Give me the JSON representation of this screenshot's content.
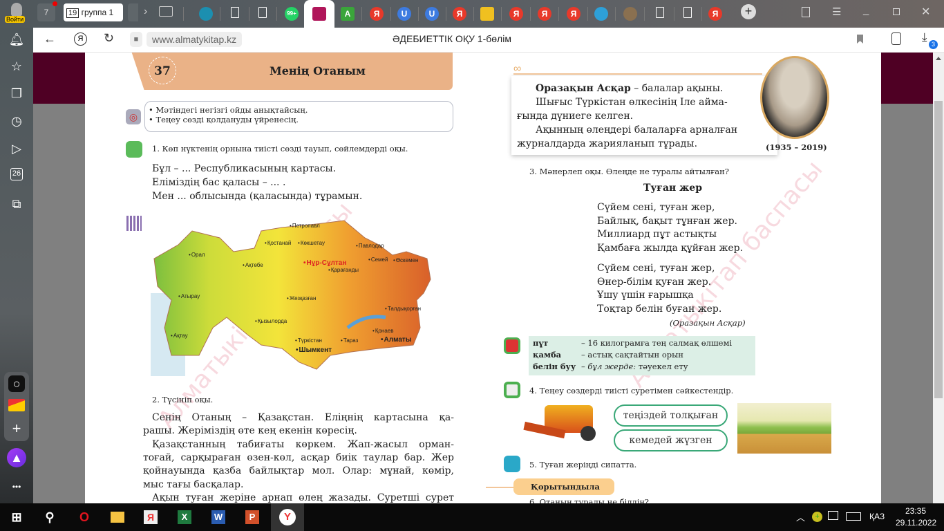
{
  "browser": {
    "profile_label": "Войти",
    "tab_counter": "7",
    "group_tab": {
      "count": "19",
      "label": "группа 1"
    },
    "tabs": [
      {
        "icon": "edge-like-icon",
        "color": "#1c8fb0",
        "label": ""
      },
      {
        "icon": "document-icon",
        "color": "#ffffff",
        "label": ""
      },
      {
        "icon": "document-icon",
        "color": "#ffffff",
        "label": ""
      },
      {
        "icon": "whatsapp-icon",
        "color": "#25d366",
        "label": "99+"
      },
      {
        "icon": "almatykitap-icon",
        "color": "#b0165a",
        "label": "",
        "active": true
      },
      {
        "icon": "a-icon",
        "color": "#3aa53a",
        "label": "A"
      },
      {
        "icon": "yandex-icon",
        "color": "#e8392a",
        "label": "Я"
      },
      {
        "icon": "u-icon",
        "color": "#3d7be0",
        "label": "U"
      },
      {
        "icon": "u-icon",
        "color": "#3d7be0",
        "label": "U"
      },
      {
        "icon": "yandex-icon",
        "color": "#e8392a",
        "label": "Я"
      },
      {
        "icon": "image-icon",
        "color": "#f0c020",
        "label": ""
      },
      {
        "icon": "yandex-icon",
        "color": "#e8392a",
        "label": "Я"
      },
      {
        "icon": "yandex-icon",
        "color": "#e8392a",
        "label": "Я"
      },
      {
        "icon": "yandex-icon",
        "color": "#e8392a",
        "label": "Я"
      },
      {
        "icon": "telegram-icon",
        "color": "#2ea0d8",
        "label": ""
      },
      {
        "icon": "ornament-icon",
        "color": "#8a7050",
        "label": ""
      },
      {
        "icon": "document-icon",
        "color": "#ffffff",
        "label": ""
      },
      {
        "icon": "document-icon",
        "color": "#ffffff",
        "label": ""
      },
      {
        "icon": "yandex-icon",
        "color": "#e8392a",
        "label": "Я"
      }
    ],
    "url": "www.almatykitap.kz",
    "page_title": "ӘДЕБИЕТТІК ОҚУ 1-бөлім",
    "downloads_badge": "3",
    "sidebar_calendar": "26"
  },
  "book": {
    "left": {
      "lesson_number": "37",
      "lesson_title": "Менің Отаным",
      "goals": [
        "• Мәтіндегі негізгі ойды анықтайсың.",
        "• Теңеу сөзді қолдануды үйренесің."
      ],
      "task1": "1. Көп нүктенің орнына тиісті сөзді тауып, сөйлемдерді оқы.",
      "task1_lines": [
        "Бұл – ... Республикасының картасы.",
        "Еліміздің бас қаласы – ... .",
        "Мен ... облысында (қаласында) тұрамын."
      ],
      "map_cities": [
        "Петропавл",
        "Қостанай",
        "Көкшетау",
        "Павлодар",
        "Орал",
        "Ақтөбе",
        "Нұр-Сұлтан",
        "Семей",
        "Өскемен",
        "Қарағанды",
        "Атырау",
        "Жезқазған",
        "Талдықорған",
        "Қызылорда",
        "Ақтау",
        "Қонаев",
        "Алматы",
        "Түркістан",
        "Тараз",
        "Шымкент"
      ],
      "task2": "2. Түсініп оқы.",
      "task2_lines": [
        "Сенің Отаның – Қазақстан. Еліңнің картасына қа-",
        "рашы. Жеріміздің өте кең екенін көресің.",
        "Қазақстанның табиғаты көркем. Жап-жасыл орман-",
        "тоғай, сарқыраған өзен-көл, асқар биік таулар бар. Жер",
        "қойнауында қазба байлықтар мол. Олар: мұнай, көмір,",
        "мыс тағы басқалар.",
        "Ақын туған жеріне арнап өлең жазады. Суретші сурет"
      ]
    },
    "right": {
      "bio_name": "Оразақын Асқар",
      "bio_rest": " – балалар ақыны.",
      "bio_lines": [
        "Шығыс Түркістан өлкесінің Іле айма-",
        "ғында дүниеге келген.",
        "Ақынның өлеңдері балаларға арналған",
        "журналдарда жарияланып тұрады."
      ],
      "years": "(1935 – 2019)",
      "task3": "3. Мәнерлеп оқы. Өлеңде не туралы айтылған?",
      "poem_title": "Туған жер",
      "poem": [
        "Сүйем сені, туған жер,",
        "Байлық, бақыт тұнған жер.",
        "Миллиард пұт астықты",
        "Қамбаға жылда құйған жер.",
        "Сүйем сені, туған жер,",
        "Өнер-білім қуған жер.",
        "Ұшу үшін ғарышқа",
        "Тоқтар белін буған жер."
      ],
      "poem_author": "(Оразақын Асқар)",
      "glossary": [
        {
          "term": "пұт",
          "def": "– 16 килограмға тең салмақ өлшемі"
        },
        {
          "term": "қамба",
          "def": "– астық сақтайтын орын"
        },
        {
          "term": "белін буу",
          "def_italic": "– бұл жерде:",
          "def": " тәуекел ету"
        }
      ],
      "task4": "4. Теңеу сөздерді тиісті суретімен сәйкестендір.",
      "bubbles": [
        "теңіздей толқыған",
        "кемедей жүзген"
      ],
      "task5": "5. Туған жеріңді сипатта.",
      "conclude": "Қорытындыла",
      "task6": "6. Отаның туралы не білдің?"
    },
    "watermark": "Алматыкітап баспасы"
  },
  "taskbar": {
    "language": "ҚАЗ",
    "time": "23:35",
    "date": "29.11.2022"
  },
  "colors": {
    "maroon": "#4f0024",
    "banner": "#eab287",
    "glossary_bg": "#dcefe6",
    "bubble_border": "#3aa878"
  }
}
